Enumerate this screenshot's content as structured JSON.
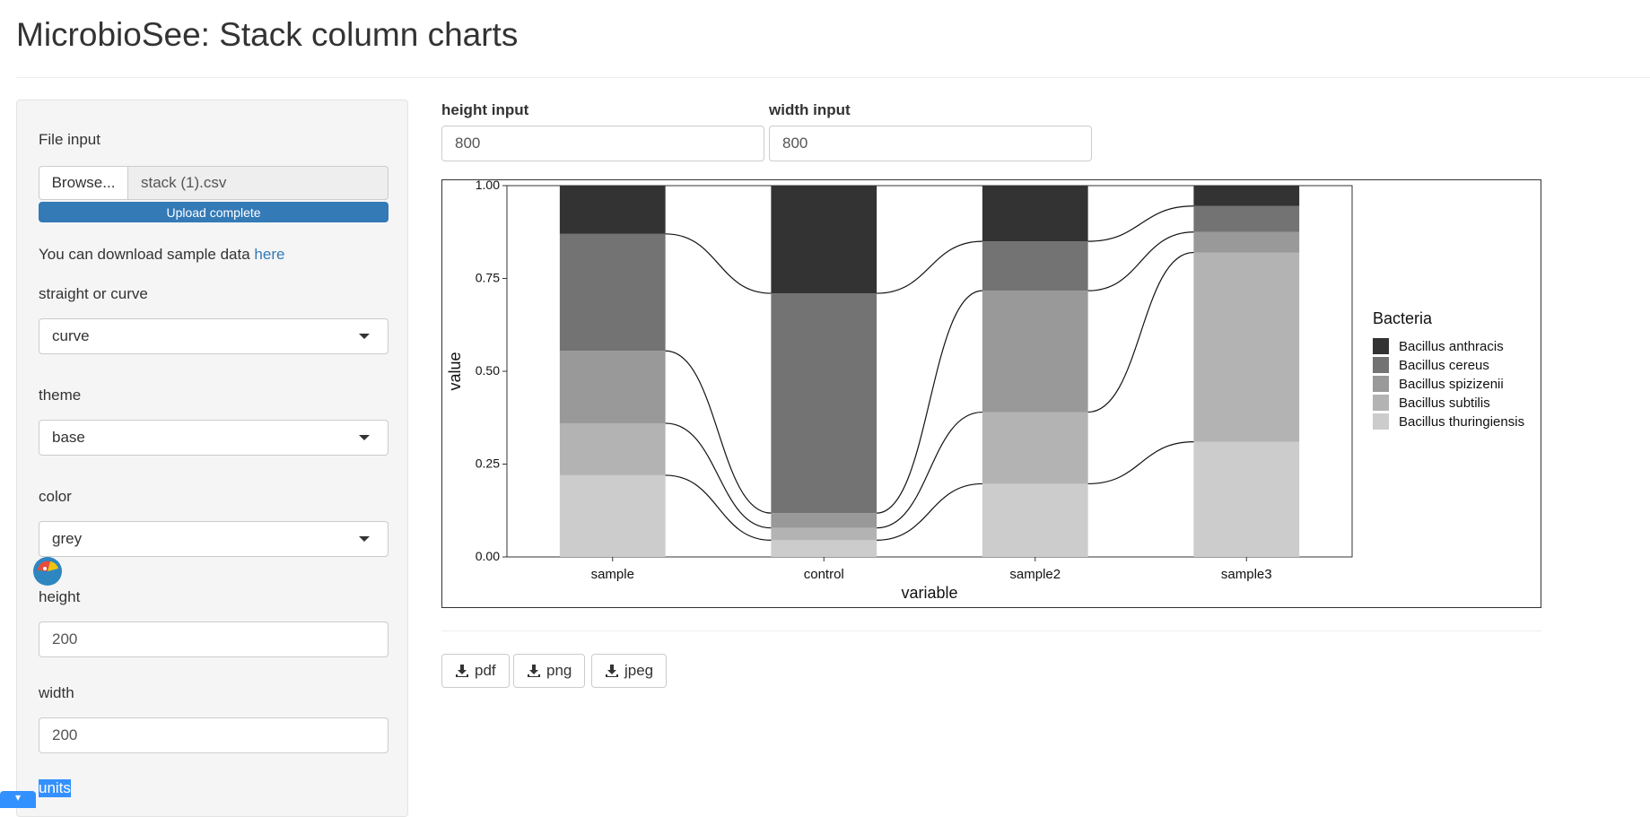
{
  "title": "MicrobioSee: Stack column charts",
  "sidebar": {
    "file_label": "File input",
    "browse_label": "Browse...",
    "file_name": "stack (1).csv",
    "progress_label": "Upload complete",
    "progress": 1.0,
    "sample_text": "You can download sample data",
    "sample_link": "here",
    "curve_label": "straight or curve",
    "curve_value": "curve",
    "theme_label": "theme",
    "theme_value": "base",
    "color_label": "color",
    "color_value": "grey",
    "height_label": "height",
    "height_value": "200",
    "width_label": "width",
    "width_value": "200",
    "units_label": "units"
  },
  "main": {
    "height_input_label": "height input",
    "height_input_value": "800",
    "width_input_label": "width input",
    "width_input_value": "800"
  },
  "downloads": {
    "pdf": "pdf",
    "png": "png",
    "jpeg": "jpeg"
  },
  "chart_data": {
    "type": "bar",
    "stacked": true,
    "curved_connectors": true,
    "categories": [
      "sample",
      "control",
      "sample2",
      "sample3"
    ],
    "series": [
      {
        "name": "Bacillus thuringiensis",
        "values": [
          0.22,
          0.045,
          0.197,
          0.31
        ],
        "color": "#cccccc"
      },
      {
        "name": "Bacillus subtilis",
        "values": [
          0.14,
          0.033,
          0.193,
          0.51
        ],
        "color": "#b3b3b3"
      },
      {
        "name": "Bacillus spizizenii",
        "values": [
          0.195,
          0.04,
          0.327,
          0.055
        ],
        "color": "#999999"
      },
      {
        "name": "Bacillus cereus",
        "values": [
          0.315,
          0.592,
          0.133,
          0.07
        ],
        "color": "#737373"
      },
      {
        "name": "Bacillus anthracis",
        "values": [
          0.13,
          0.29,
          0.15,
          0.055
        ],
        "color": "#333333"
      }
    ],
    "xlabel": "variable",
    "ylabel": "value",
    "ylim": [
      0,
      1
    ],
    "yticks": [
      "0.00",
      "0.25",
      "0.50",
      "0.75",
      "1.00"
    ],
    "legend_title": "Bacteria",
    "legend": [
      "Bacillus anthracis",
      "Bacillus cereus",
      "Bacillus spizizenii",
      "Bacillus subtilis",
      "Bacillus thuringiensis"
    ],
    "legend_position": "right",
    "grid": false
  }
}
